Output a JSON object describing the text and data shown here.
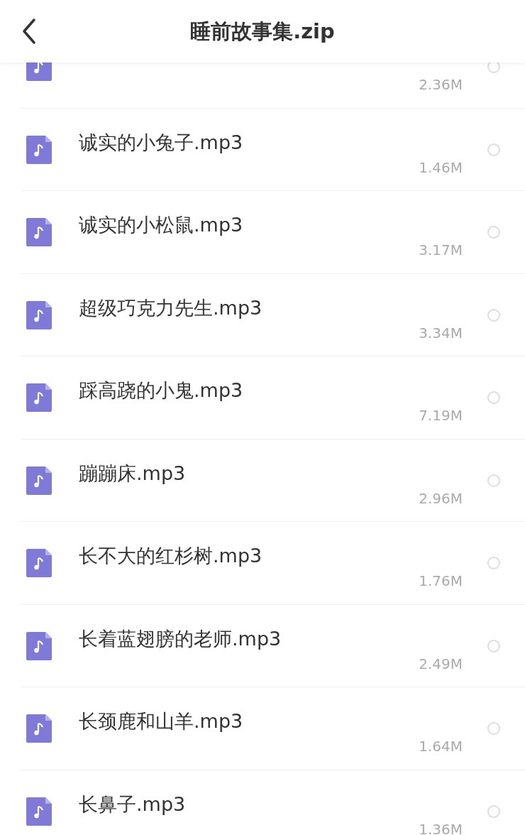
{
  "header": {
    "title": "睡前故事集.zip"
  },
  "files": [
    {
      "size": "2.36M",
      "selected": false
    },
    {
      "name": "诚实的小兔子.mp3",
      "size": "1.46M",
      "selected": false
    },
    {
      "name": "诚实的小松鼠.mp3",
      "size": "3.17M",
      "selected": false
    },
    {
      "name": "超级巧克力先生.mp3",
      "size": "3.34M",
      "selected": false
    },
    {
      "name": "踩高跷的小鬼.mp3",
      "size": "7.19M",
      "selected": false
    },
    {
      "name": "蹦蹦床.mp3",
      "size": "2.96M",
      "selected": false
    },
    {
      "name": "长不大的红杉树.mp3",
      "size": "1.76M",
      "selected": false
    },
    {
      "name": "长着蓝翅膀的老师.mp3",
      "size": "2.49M",
      "selected": false
    },
    {
      "name": "长颈鹿和山羊.mp3",
      "size": "1.64M",
      "selected": false
    },
    {
      "name": "长鼻子.mp3",
      "size": "1.36M",
      "selected": false
    }
  ]
}
